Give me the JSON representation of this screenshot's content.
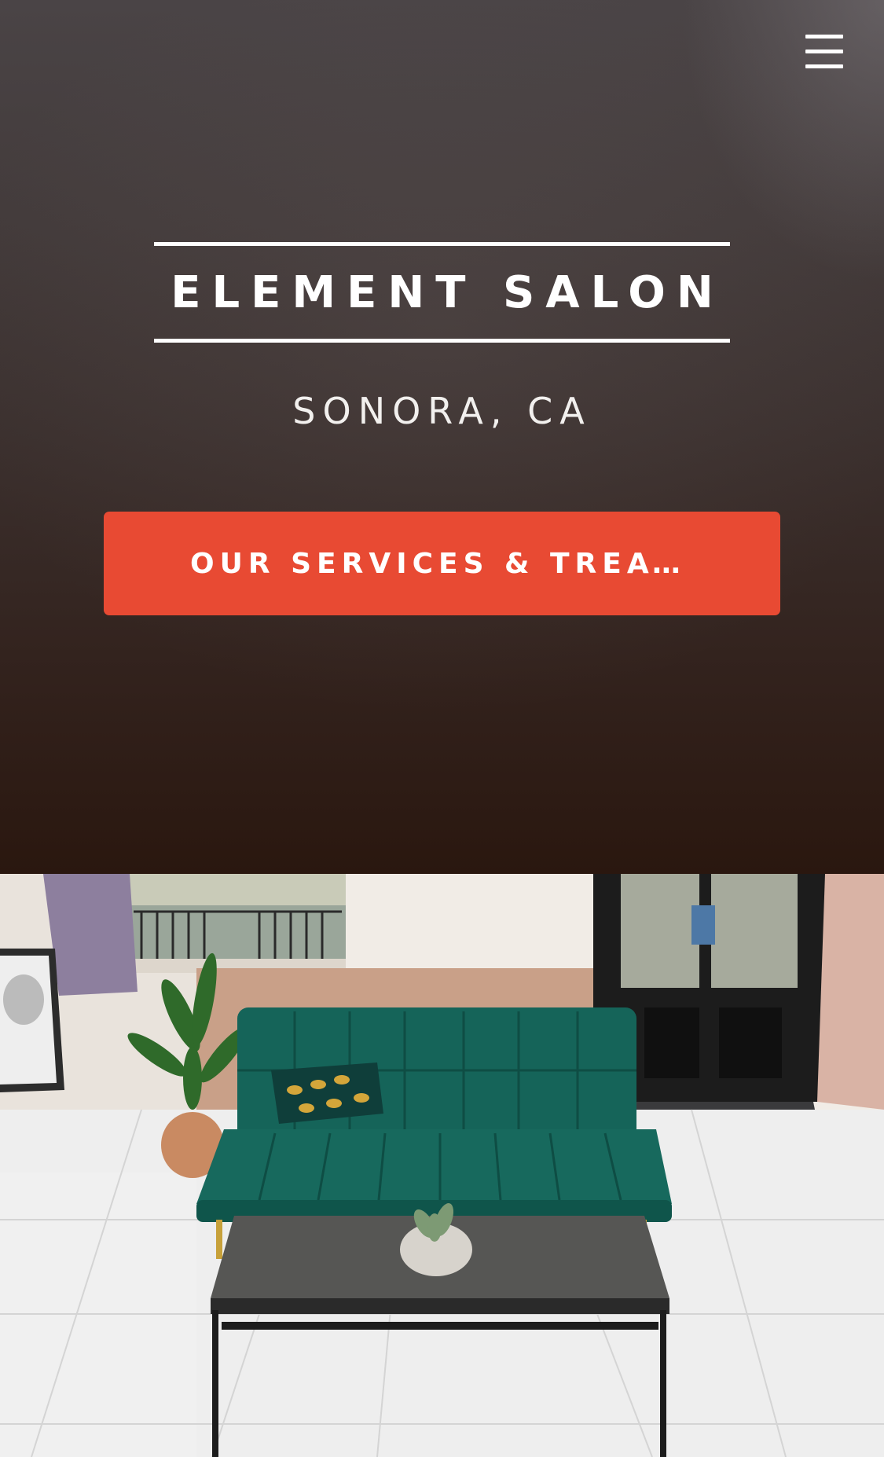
{
  "header": {
    "menu_icon": "hamburger-menu-icon"
  },
  "hero": {
    "title": "ELEMENT SALON",
    "location": "SONORA, CA",
    "cta_label": "OUR SERVICES & TREATME…"
  },
  "gallery": {
    "image_icon": "salon-lounge-photo"
  },
  "colors": {
    "accent": "#e84a33",
    "sofa": "#136057",
    "hero_bg_top": "#4a4446",
    "hero_bg_bottom": "#2a170f"
  }
}
